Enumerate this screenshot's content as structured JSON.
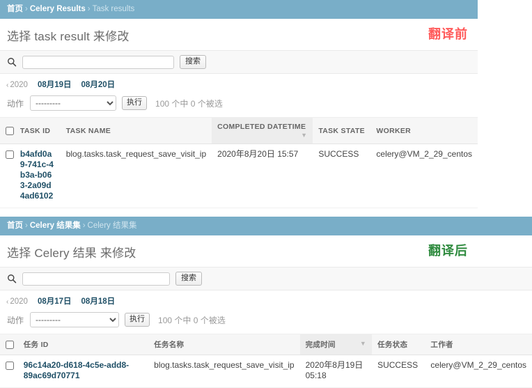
{
  "sections": [
    {
      "id": "before",
      "annotation": "翻译前",
      "annotation_color": "#ff5a5a",
      "breadcrumb": {
        "home": "首页",
        "app": "Celery Results",
        "current": "Task results",
        "separator": "›"
      },
      "page_title": "选择 task result 来修改",
      "search": {
        "icon": "search-icon",
        "value": "",
        "placeholder": "",
        "button_label": "搜索"
      },
      "date_hierarchy": {
        "back_arrow": "‹",
        "year": "2020",
        "days": [
          "08月19日",
          "08月20日"
        ]
      },
      "actions": {
        "label": "动作",
        "selected": "---------",
        "options": [
          "---------"
        ],
        "go_label": "执行",
        "count_text": "100 个中 0 个被选"
      },
      "table": {
        "select_all_checked": false,
        "columns": [
          {
            "label": "TASK ID",
            "sorted": false
          },
          {
            "label": "TASK NAME",
            "sorted": false
          },
          {
            "label": "COMPLETED DATETIME",
            "sorted": true,
            "sort_arrow": "▼"
          },
          {
            "label": "TASK STATE",
            "sorted": false
          },
          {
            "label": "WORKER",
            "sorted": false
          }
        ],
        "rows": [
          {
            "checked": false,
            "task_id": "b4afd0a9-741c-4b3a-b063-2a09d4ad6102",
            "task_name": "blog.tasks.task_request_save_visit_ip",
            "completed_datetime": "2020年8月20日 15:57",
            "task_state": "SUCCESS",
            "worker": "celery@VM_2_29_centos"
          }
        ]
      }
    },
    {
      "id": "after",
      "annotation": "翻译后",
      "annotation_color": "#2f8b3f",
      "breadcrumb": {
        "home": "首页",
        "app": "Celery 结果集",
        "current": "Celery 结果集",
        "separator": "›"
      },
      "page_title": "选择 Celery 结果 来修改",
      "search": {
        "icon": "search-icon",
        "value": "",
        "placeholder": "",
        "button_label": "搜索"
      },
      "date_hierarchy": {
        "back_arrow": "‹",
        "year": "2020",
        "days": [
          "08月17日",
          "08月18日"
        ]
      },
      "actions": {
        "label": "动作",
        "selected": "---------",
        "options": [
          "---------"
        ],
        "go_label": "执行",
        "count_text": "100 个中 0 个被选"
      },
      "table": {
        "select_all_checked": false,
        "columns": [
          {
            "label": "任务 ID",
            "sorted": false
          },
          {
            "label": "任务名称",
            "sorted": false
          },
          {
            "label": "完成时间",
            "sorted": true,
            "sort_arrow": "▼"
          },
          {
            "label": "任务状态",
            "sorted": false
          },
          {
            "label": "工作者",
            "sorted": false
          }
        ],
        "rows": [
          {
            "checked": false,
            "task_id": "96c14a20-d618-4c5e-add8-89ac69d70771",
            "task_name": "blog.tasks.task_request_save_visit_ip",
            "completed_datetime": "2020年8月19日 05:18",
            "task_state": "SUCCESS",
            "worker": "celery@VM_2_29_centos"
          }
        ]
      }
    }
  ],
  "theme": {
    "breadcrumb_bg": "#79aec8",
    "link_color": "#205067",
    "header_bg": "#f6f6f6",
    "sorted_header_bg": "#ededed"
  }
}
